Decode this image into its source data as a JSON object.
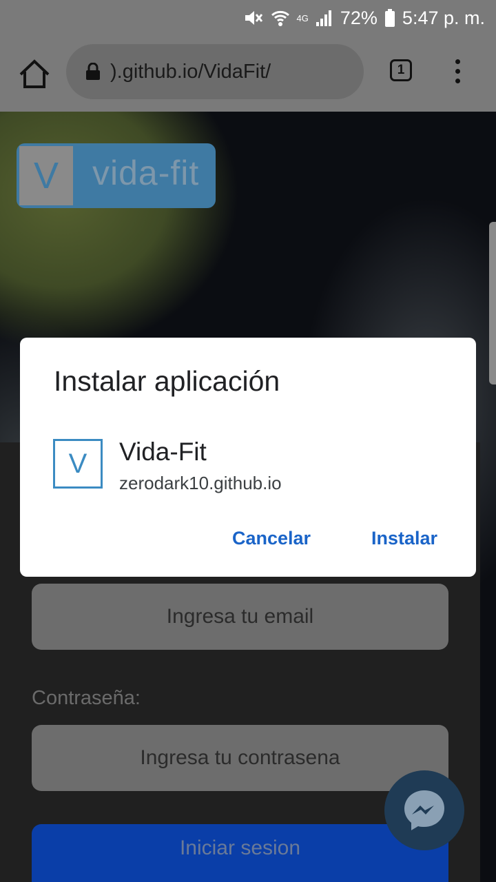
{
  "status_bar": {
    "battery": "72%",
    "time": "5:47 p. m.",
    "network": "4G"
  },
  "browser": {
    "url": ").github.io/VidaFit/",
    "tab_count": "1"
  },
  "page": {
    "logo_letter": "V",
    "logo_text": "vida-fit",
    "email_placeholder": "Ingresa tu email",
    "password_label": "Contraseña:",
    "password_placeholder": "Ingresa tu contrasena",
    "login_button": "Iniciar sesion"
  },
  "dialog": {
    "title": "Instalar aplicación",
    "app_icon_letter": "V",
    "app_name": "Vida-Fit",
    "app_url": "zerodark10.github.io",
    "cancel_label": "Cancelar",
    "install_label": "Instalar"
  },
  "colors": {
    "accent": "#1a64c8",
    "brand": "#3b8bc2",
    "login_button": "#0a3ea8"
  }
}
